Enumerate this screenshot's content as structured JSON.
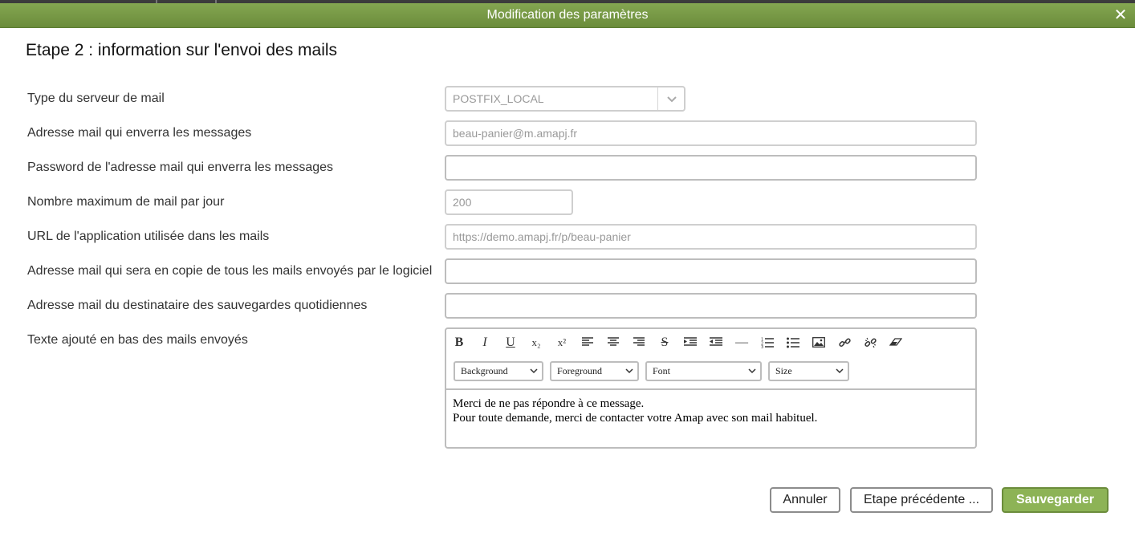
{
  "window": {
    "title": "Modification des paramètres",
    "close_glyph": "✕"
  },
  "step_title": "Etape 2 : information sur l'envoi des mails",
  "fields": {
    "server_type": {
      "label": "Type du serveur de mail",
      "value": "POSTFIX_LOCAL"
    },
    "sender_email": {
      "label": "Adresse mail qui enverra les messages",
      "value": "beau-panier@m.amapj.fr"
    },
    "sender_password": {
      "label": "Password de l'adresse mail qui enverra les messages",
      "value": ""
    },
    "max_mail_per_day": {
      "label": "Nombre maximum de mail par jour",
      "value": "200"
    },
    "app_url": {
      "label": "URL de l'application utilisée dans les mails",
      "value": "https://demo.amapj.fr/p/beau-panier"
    },
    "cc_email": {
      "label": "Adresse mail qui sera en copie de tous les mails envoyés par le logiciel",
      "value": ""
    },
    "backup_email": {
      "label": "Adresse mail du destinataire des sauvegardes quotidiennes",
      "value": ""
    },
    "footer_text": {
      "label": "Texte ajouté en bas des mails envoyés",
      "lines": [
        "Merci de ne pas répondre à ce message.",
        "Pour toute demande, merci de contacter votre Amap avec son mail habituel."
      ]
    }
  },
  "editor_toolbar": {
    "buttons": [
      {
        "name": "bold-icon",
        "glyph": "B"
      },
      {
        "name": "italic-icon",
        "glyph": "I"
      },
      {
        "name": "underline-icon",
        "glyph": "U"
      },
      {
        "name": "subscript-icon",
        "glyph": "x₂"
      },
      {
        "name": "superscript-icon",
        "glyph": "x²"
      },
      {
        "name": "align-left-icon",
        "glyph": ""
      },
      {
        "name": "align-center-icon",
        "glyph": ""
      },
      {
        "name": "align-right-icon",
        "glyph": ""
      },
      {
        "name": "strikethrough-icon",
        "glyph": "S"
      },
      {
        "name": "indent-icon",
        "glyph": ""
      },
      {
        "name": "outdent-icon",
        "glyph": ""
      },
      {
        "name": "horizontal-rule-icon",
        "glyph": "—"
      },
      {
        "name": "ordered-list-icon",
        "glyph": ""
      },
      {
        "name": "unordered-list-icon",
        "glyph": ""
      },
      {
        "name": "image-icon",
        "glyph": ""
      },
      {
        "name": "link-icon",
        "glyph": ""
      },
      {
        "name": "unlink-icon",
        "glyph": ""
      },
      {
        "name": "eraser-icon",
        "glyph": ""
      }
    ],
    "selects": {
      "background": "Background",
      "foreground": "Foreground",
      "font": "Font",
      "size": "Size"
    }
  },
  "buttons": {
    "cancel": "Annuler",
    "previous": "Etape précédente ...",
    "save": "Sauvegarder"
  },
  "colors": {
    "titlebar": "#6f913d",
    "primary_button": "#8db356"
  }
}
